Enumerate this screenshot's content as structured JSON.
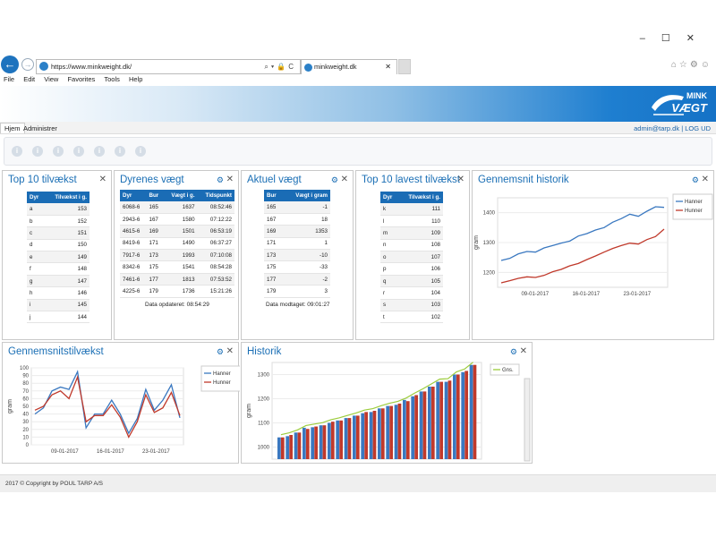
{
  "browser": {
    "url": "https://www.minkweight.dk/",
    "tab_title": "minkweight.dk",
    "menu": [
      "File",
      "Edit",
      "View",
      "Favorites",
      "Tools",
      "Help"
    ]
  },
  "logo": {
    "line1": "MINK",
    "line2": "VÆGT"
  },
  "nav": {
    "home": "Hjem",
    "admin": "Administrer",
    "user": "admin@tarp.dk",
    "separator": " | ",
    "logout": "LOG UD"
  },
  "toolbar_icons": [
    "i",
    "i",
    "i",
    "i",
    "i",
    "i",
    "i"
  ],
  "top10": {
    "title": "Top 10 tilvækst",
    "headers": [
      "Dyr",
      "Tilvækst i g."
    ],
    "rows": [
      [
        "a",
        "153"
      ],
      [
        "b",
        "152"
      ],
      [
        "c",
        "151"
      ],
      [
        "d",
        "150"
      ],
      [
        "e",
        "149"
      ],
      [
        "f",
        "148"
      ],
      [
        "g",
        "147"
      ],
      [
        "h",
        "146"
      ],
      [
        "i",
        "145"
      ],
      [
        "j",
        "144"
      ]
    ]
  },
  "weights": {
    "title": "Dyrenes vægt",
    "headers": [
      "Dyr",
      "Bur",
      "Vægt i g.",
      "Tidspunkt"
    ],
    "rows": [
      [
        "6068-6",
        "165",
        "1637",
        "08:52:46"
      ],
      [
        "2943-6",
        "167",
        "1580",
        "07:12:22"
      ],
      [
        "4615-6",
        "169",
        "1501",
        "06:53:19"
      ],
      [
        "8419-6",
        "171",
        "1490",
        "06:37:27"
      ],
      [
        "7917-6",
        "173",
        "1993",
        "07:10:08"
      ],
      [
        "8342-6",
        "175",
        "1541",
        "08:54:28"
      ],
      [
        "7461-6",
        "177",
        "1813",
        "07:53:52"
      ],
      [
        "4225-6",
        "179",
        "1736",
        "15:21:26"
      ]
    ],
    "note": "Data opdateret: 08:54:29"
  },
  "current": {
    "title": "Aktuel vægt",
    "headers": [
      "Bur",
      "Vægt i gram"
    ],
    "rows": [
      [
        "165",
        "-1"
      ],
      [
        "167",
        "18"
      ],
      [
        "169",
        "1353"
      ],
      [
        "171",
        "1"
      ],
      [
        "173",
        "-10"
      ],
      [
        "175",
        "-33"
      ],
      [
        "177",
        "-2"
      ],
      [
        "179",
        "3"
      ]
    ],
    "note": "Data modtaget: 09:01:27"
  },
  "lowest": {
    "title": "Top 10 lavest tilvækst",
    "headers": [
      "Dyr",
      "Tilvækst i g."
    ],
    "rows": [
      [
        "k",
        "111"
      ],
      [
        "l",
        "110"
      ],
      [
        "m",
        "109"
      ],
      [
        "n",
        "108"
      ],
      [
        "o",
        "107"
      ],
      [
        "p",
        "106"
      ],
      [
        "q",
        "105"
      ],
      [
        "r",
        "104"
      ],
      [
        "s",
        "103"
      ],
      [
        "t",
        "102"
      ]
    ]
  },
  "colors": {
    "hanner": "#3a78c0",
    "hunner": "#c0392b",
    "gns": "#9ccc3c",
    "accent": "#1b6fb5"
  },
  "chart_data": [
    {
      "id": "avg-history",
      "type": "line",
      "title": "Gennemsnit historik",
      "ylabel": "gram",
      "ylim": [
        1150,
        1450
      ],
      "yticks": [
        1200,
        1300,
        1400
      ],
      "xtick_labels": [
        "09-01-2017",
        "16-01-2017",
        "23-01-2017"
      ],
      "series": [
        {
          "name": "Hanner",
          "values": [
            1240,
            1247,
            1262,
            1270,
            1268,
            1282,
            1290,
            1298,
            1305,
            1322,
            1330,
            1342,
            1350,
            1368,
            1380,
            1395,
            1388,
            1405,
            1420,
            1418
          ]
        },
        {
          "name": "Hunner",
          "values": [
            1165,
            1172,
            1180,
            1185,
            1183,
            1190,
            1202,
            1210,
            1222,
            1230,
            1243,
            1255,
            1268,
            1280,
            1290,
            1298,
            1295,
            1310,
            1320,
            1345
          ]
        }
      ]
    },
    {
      "id": "avg-growth",
      "type": "line",
      "title": "Gennemsnitstilvækst",
      "ylabel": "gram",
      "ylim": [
        0,
        100
      ],
      "yticks": [
        0,
        10,
        20,
        30,
        40,
        50,
        60,
        70,
        80,
        90,
        100
      ],
      "xtick_labels": [
        "09-01-2017",
        "16-01-2017",
        "23-01-2017"
      ],
      "series": [
        {
          "name": "Hanner",
          "values": [
            40,
            48,
            70,
            75,
            72,
            95,
            22,
            40,
            40,
            58,
            40,
            15,
            34,
            72,
            45,
            58,
            78,
            35
          ]
        },
        {
          "name": "Hunner",
          "values": [
            45,
            50,
            65,
            70,
            60,
            88,
            30,
            38,
            38,
            52,
            36,
            10,
            30,
            65,
            42,
            48,
            68,
            38
          ]
        }
      ]
    },
    {
      "id": "history",
      "type": "bar",
      "title": "Historik",
      "ylabel": "gram",
      "ylim": [
        950,
        1350
      ],
      "yticks": [
        1000,
        1100,
        1200,
        1300
      ],
      "series": [
        {
          "name": "Hanner",
          "values": [
            1040,
            1045,
            1060,
            1080,
            1082,
            1090,
            1100,
            1110,
            1120,
            1130,
            1140,
            1145,
            1160,
            1170,
            1175,
            1195,
            1210,
            1230,
            1250,
            1270,
            1270,
            1300,
            1310,
            1340
          ]
        },
        {
          "name": "Hunner",
          "values": [
            1040,
            1050,
            1060,
            1075,
            1085,
            1090,
            1105,
            1110,
            1120,
            1130,
            1145,
            1150,
            1160,
            1170,
            1180,
            1190,
            1215,
            1230,
            1250,
            1270,
            1275,
            1300,
            1315,
            1340
          ]
        },
        {
          "name": "Gns.",
          "values": [
            1040,
            1048,
            1060,
            1078,
            1084,
            1090,
            1102,
            1110,
            1120,
            1130,
            1142,
            1148,
            1160,
            1170,
            1178,
            1192,
            1212,
            1230,
            1250,
            1270,
            1272,
            1300,
            1312,
            1340
          ]
        }
      ]
    }
  ],
  "footer": "2017 © Copyright by POUL TARP A/S"
}
